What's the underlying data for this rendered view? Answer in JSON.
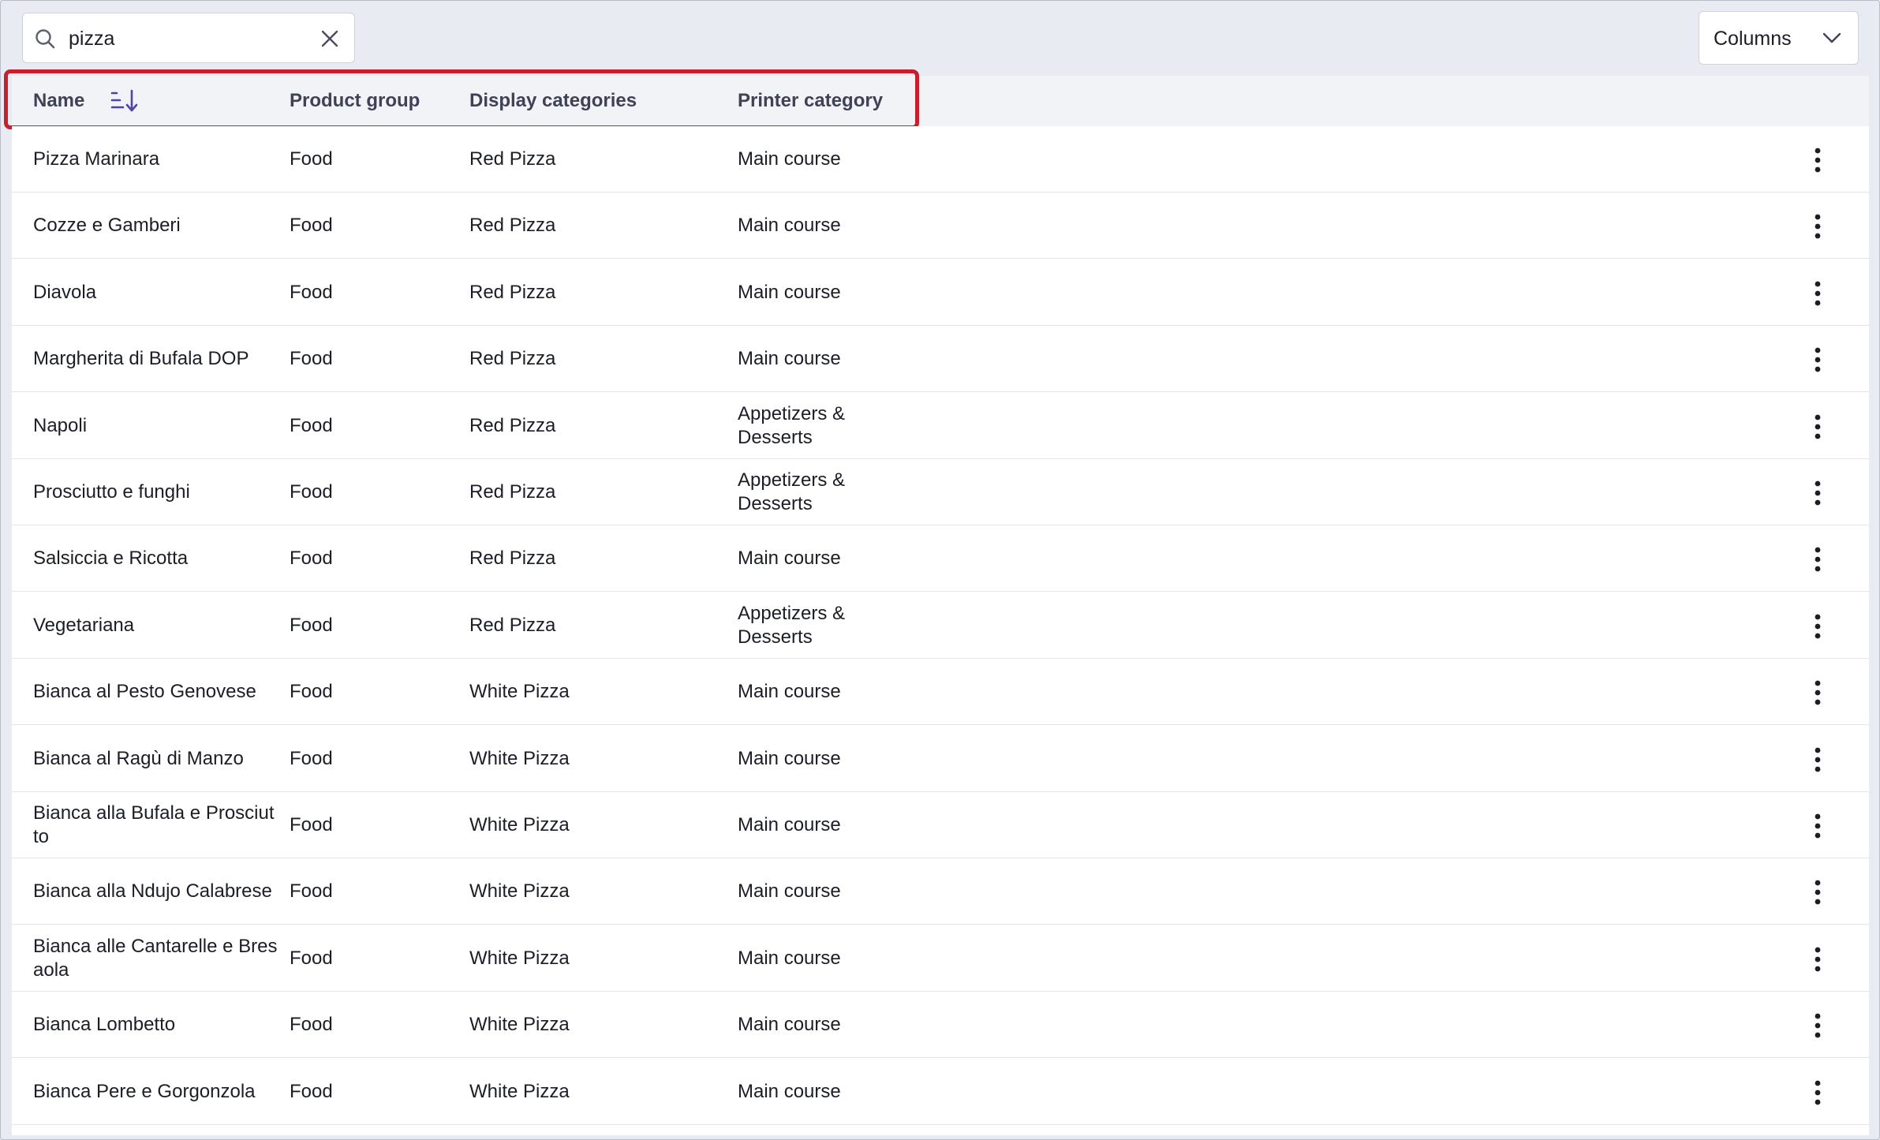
{
  "search": {
    "value": "pizza",
    "icon": "search-icon",
    "clear_icon": "close-icon"
  },
  "columns_button": {
    "label": "Columns",
    "icon": "chevron-down-icon"
  },
  "table": {
    "headers": {
      "name": "Name",
      "product_group": "Product group",
      "display_categories": "Display categories",
      "printer_category": "Printer category"
    },
    "sort_icon": "sort-ascending-icon",
    "accent_color": "#4b45a8",
    "highlight_color": "#c5202e",
    "rows": [
      {
        "name": "Pizza Marinara",
        "group": "Food",
        "display": "Red Pizza",
        "printer": "Main course"
      },
      {
        "name": "Cozze e Gamberi",
        "group": "Food",
        "display": "Red Pizza",
        "printer": "Main course"
      },
      {
        "name": "Diavola",
        "group": "Food",
        "display": "Red Pizza",
        "printer": "Main course"
      },
      {
        "name": "Margherita di Bufala DOP",
        "group": "Food",
        "display": "Red Pizza",
        "printer": "Main course"
      },
      {
        "name": "Napoli",
        "group": "Food",
        "display": "Red Pizza",
        "printer": "Appetizers & Desserts"
      },
      {
        "name": "Prosciutto e funghi",
        "group": "Food",
        "display": "Red Pizza",
        "printer": "Appetizers & Desserts"
      },
      {
        "name": "Salsiccia e Ricotta",
        "group": "Food",
        "display": "Red Pizza",
        "printer": "Main course"
      },
      {
        "name": "Vegetariana",
        "group": "Food",
        "display": "Red Pizza",
        "printer": "Appetizers & Desserts"
      },
      {
        "name": "Bianca al Pesto Genovese",
        "group": "Food",
        "display": "White Pizza",
        "printer": "Main course"
      },
      {
        "name": "Bianca al Ragù di Manzo",
        "group": "Food",
        "display": "White Pizza",
        "printer": "Main course"
      },
      {
        "name": "Bianca alla Bufala e Prosciutto",
        "group": "Food",
        "display": "White Pizza",
        "printer": "Main course"
      },
      {
        "name": "Bianca alla Ndujo Calabrese",
        "group": "Food",
        "display": "White Pizza",
        "printer": "Main course"
      },
      {
        "name": "Bianca alle Cantarelle e Bresaola",
        "group": "Food",
        "display": "White Pizza",
        "printer": "Main course"
      },
      {
        "name": "Bianca Lombetto",
        "group": "Food",
        "display": "White Pizza",
        "printer": "Main course"
      },
      {
        "name": "Bianca Pere e Gorgonzola",
        "group": "Food",
        "display": "White Pizza",
        "printer": "Main course"
      }
    ],
    "row_menu_icon": "more-vertical-icon"
  }
}
